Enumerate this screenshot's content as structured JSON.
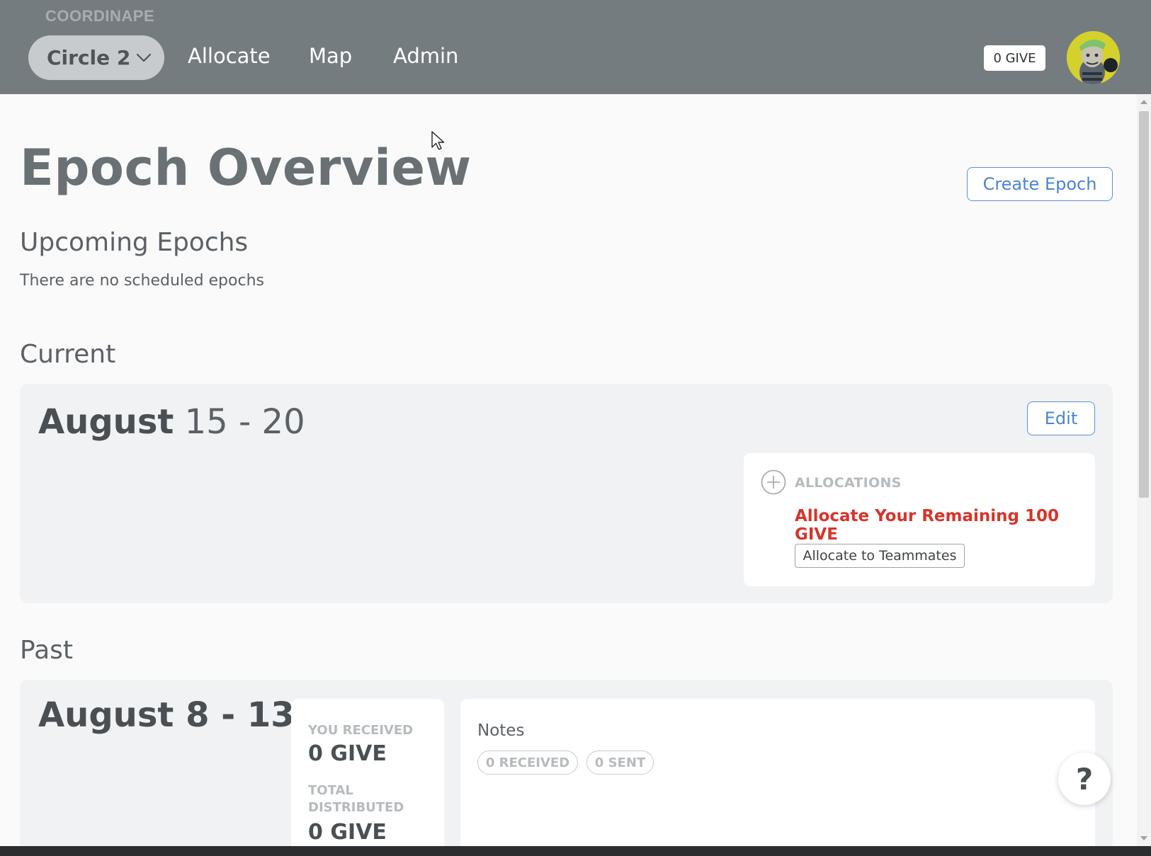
{
  "header": {
    "brand": "COORDINAPE",
    "circle_selector": "Circle 2",
    "nav": [
      "Allocate",
      "Map",
      "Admin"
    ],
    "give_balance": "0 GIVE"
  },
  "main": {
    "title": "Epoch Overview",
    "create_epoch_label": "Create Epoch",
    "upcoming": {
      "heading": "Upcoming Epochs",
      "empty_text": "There are no scheduled epochs"
    },
    "current": {
      "heading": "Current",
      "month": "August",
      "range": "15 - 20",
      "edit_label": "Edit",
      "allocations": {
        "label": "ALLOCATIONS",
        "remaining_text": "Allocate Your Remaining 100 GIVE",
        "button_label": "Allocate to Teammates"
      }
    },
    "past": {
      "heading": "Past",
      "month": "August",
      "range": "8 - 13",
      "you_received_label": "YOU RECEIVED",
      "you_received_value": "0 GIVE",
      "total_distributed_label_1": "TOTAL",
      "total_distributed_label_2": "DISTRIBUTED",
      "total_distributed_value": "0 GIVE",
      "notes_title": "Notes",
      "received_pill": "0 RECEIVED",
      "sent_pill": "0 SENT"
    },
    "help_label": "?"
  },
  "colors": {
    "header_bg": "#757c80",
    "accent_blue": "#4a84d4",
    "alert_red": "#d6352a",
    "card_bg": "#f0f2f4"
  }
}
